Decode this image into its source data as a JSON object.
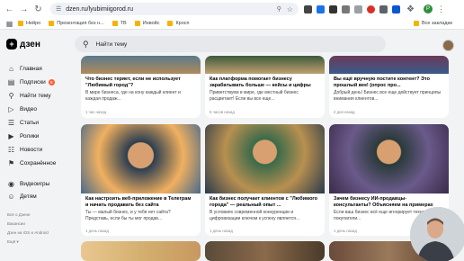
{
  "browser": {
    "url": "dzen.ru/lyubimiigorod.ru",
    "bookmarks": [
      "Нейро",
      "Презентация без н...",
      "ТВ",
      "Инвойс",
      "Кросп"
    ],
    "all_bookmarks_label": "Все закладки",
    "profile_letter": "P"
  },
  "header": {
    "logo_text": "дзен",
    "search_placeholder": "Найти тему"
  },
  "sidebar": {
    "items": [
      {
        "label": "Главная",
        "icon": "home-icon"
      },
      {
        "label": "Подписки",
        "icon": "subscriptions-icon",
        "badge": "9"
      },
      {
        "label": "Найти тему",
        "icon": "search-icon"
      },
      {
        "label": "Видео",
        "icon": "video-icon"
      },
      {
        "label": "Статьи",
        "icon": "articles-icon"
      },
      {
        "label": "Ролики",
        "icon": "clips-icon"
      },
      {
        "label": "Новости",
        "icon": "news-icon"
      },
      {
        "label": "Сохранённое",
        "icon": "bookmark-icon"
      },
      {
        "label": "Видеоигры",
        "icon": "gamepad-icon"
      },
      {
        "label": "Детям",
        "icon": "kids-icon"
      }
    ],
    "footer": [
      "Всё о Дзене",
      "Вакансии",
      "Дзен на iOS и Android",
      "Ещё"
    ]
  },
  "feed": {
    "row1": [
      {
        "title": "Что бизнес теряет, если не использует \"Любимый город\"?",
        "desc": "В мире бизнеса, где на кону каждый клиент и каждая продаж...",
        "time": "1 час назад"
      },
      {
        "title": "Как платформа помогает бизнесу зарабатывать больше — кейсы и цифры",
        "desc": "Приветствуем в мире, где местный бизнес расцветает! Если вы все еще...",
        "time": "5 часов назад"
      },
      {
        "title": "Вы ещё вручную постите контент? Это прошлый век! (опрос про...",
        "desc": "Добрый день! Бизнес все еще действует принципы внимания клиентов...",
        "time": "2 дня назад"
      }
    ],
    "row2": [
      {
        "title": "Как настроить веб-приложение в Телеграм и начать продавать без сайта",
        "desc": "Ты — малый бизнес, и у тебя нет сайта? Представь, если бы ты мог продав...",
        "time": "1 день назад"
      },
      {
        "title": "Как бизнес получает клиентов с \"Любимого города\" — реальный опыт ...",
        "desc": "В условиях современной конкуренции и цифровизации ключом к успеху является...",
        "time": "1 день назад"
      },
      {
        "title": "Зачем бизнесу ИИ-продавцы-консультанты? Объясняем на примерах",
        "desc": "Если ваш бизнес всё еще игнорирует технологии, покупатели...",
        "time": "1 день назад"
      }
    ]
  }
}
